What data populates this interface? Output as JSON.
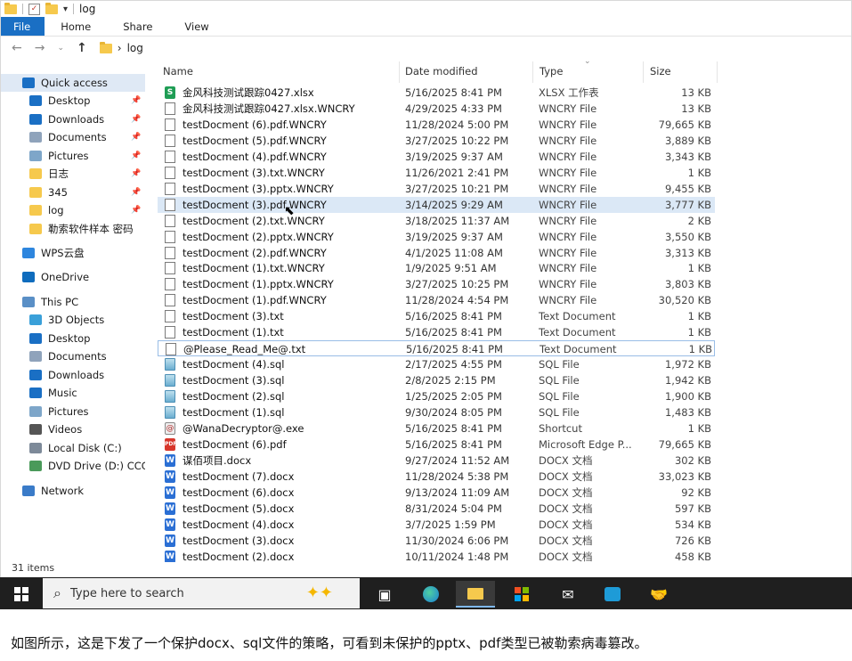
{
  "window": {
    "title": "log",
    "ribbon_tabs": [
      "File",
      "Home",
      "Share",
      "View"
    ],
    "address": "log",
    "breadcrumb_sep": "›"
  },
  "sidebar": {
    "items": [
      {
        "label": "Quick access",
        "icon": "star-icon",
        "color": "#1a6fc4",
        "pinned": false,
        "indent": 0,
        "selected": true
      },
      {
        "label": "Desktop",
        "icon": "desktop-icon",
        "color": "#1a6fc4",
        "pinned": true,
        "indent": 1
      },
      {
        "label": "Downloads",
        "icon": "download-icon",
        "color": "#1a6fc4",
        "pinned": true,
        "indent": 1
      },
      {
        "label": "Documents",
        "icon": "documents-icon",
        "color": "#8fa3bb",
        "pinned": true,
        "indent": 1
      },
      {
        "label": "Pictures",
        "icon": "pictures-icon",
        "color": "#7ea6c9",
        "pinned": true,
        "indent": 1
      },
      {
        "label": "日志",
        "icon": "folder-icon",
        "color": "#f6c94d",
        "pinned": true,
        "indent": 1
      },
      {
        "label": "345",
        "icon": "folder-icon",
        "color": "#f6c94d",
        "pinned": true,
        "indent": 1
      },
      {
        "label": "log",
        "icon": "folder-icon",
        "color": "#f6c94d",
        "pinned": true,
        "indent": 1
      },
      {
        "label": "勒索软件样本 密码",
        "icon": "folder-icon",
        "color": "#f6c94d",
        "pinned": false,
        "indent": 1
      },
      {
        "label": "WPS云盘",
        "icon": "cloud-icon",
        "color": "#2e86de",
        "pinned": false,
        "indent": 0
      },
      {
        "label": "OneDrive",
        "icon": "onedrive-icon",
        "color": "#0f6cbd",
        "pinned": false,
        "indent": 0
      },
      {
        "label": "This PC",
        "icon": "computer-icon",
        "color": "#5a8fc6",
        "pinned": false,
        "indent": 0
      },
      {
        "label": "3D Objects",
        "icon": "cube-icon",
        "color": "#3aa0d9",
        "pinned": false,
        "indent": 1
      },
      {
        "label": "Desktop",
        "icon": "desktop-icon",
        "color": "#1a6fc4",
        "pinned": false,
        "indent": 1
      },
      {
        "label": "Documents",
        "icon": "documents-icon",
        "color": "#8fa3bb",
        "pinned": false,
        "indent": 1
      },
      {
        "label": "Downloads",
        "icon": "download-icon",
        "color": "#1a6fc4",
        "pinned": false,
        "indent": 1
      },
      {
        "label": "Music",
        "icon": "music-icon",
        "color": "#1a6fc4",
        "pinned": false,
        "indent": 1
      },
      {
        "label": "Pictures",
        "icon": "pictures-icon",
        "color": "#7ea6c9",
        "pinned": false,
        "indent": 1
      },
      {
        "label": "Videos",
        "icon": "video-icon",
        "color": "#555555",
        "pinned": false,
        "indent": 1
      },
      {
        "label": "Local Disk (C:)",
        "icon": "disk-icon",
        "color": "#7d8a99",
        "pinned": false,
        "indent": 1
      },
      {
        "label": "DVD Drive (D:) CCC",
        "icon": "dvd-icon",
        "color": "#4a9a5a",
        "pinned": false,
        "indent": 1
      },
      {
        "label": "Network",
        "icon": "network-icon",
        "color": "#3a7bc8",
        "pinned": false,
        "indent": 0
      }
    ]
  },
  "columns": {
    "name": "Name",
    "date": "Date modified",
    "type": "Type",
    "size": "Size"
  },
  "files": [
    {
      "name": "金风科技测试跟踪0427.xlsx",
      "date": "5/16/2025 8:41 PM",
      "type": "XLSX 工作表",
      "size": "13 KB",
      "icon": "xlsx"
    },
    {
      "name": "金风科技测试跟踪0427.xlsx.WNCRY",
      "date": "4/29/2025 4:33 PM",
      "type": "WNCRY File",
      "size": "13 KB",
      "icon": "doc"
    },
    {
      "name": "testDocment (6).pdf.WNCRY",
      "date": "11/28/2024 5:00 PM",
      "type": "WNCRY File",
      "size": "79,665 KB",
      "icon": "doc"
    },
    {
      "name": "testDocment (5).pdf.WNCRY",
      "date": "3/27/2025 10:22 PM",
      "type": "WNCRY File",
      "size": "3,889 KB",
      "icon": "doc"
    },
    {
      "name": "testDocment (4).pdf.WNCRY",
      "date": "3/19/2025 9:37 AM",
      "type": "WNCRY File",
      "size": "3,343 KB",
      "icon": "doc"
    },
    {
      "name": "testDocment (3).txt.WNCRY",
      "date": "11/26/2021 2:41 PM",
      "type": "WNCRY File",
      "size": "1 KB",
      "icon": "doc"
    },
    {
      "name": "testDocment (3).pptx.WNCRY",
      "date": "3/27/2025 10:21 PM",
      "type": "WNCRY File",
      "size": "9,455 KB",
      "icon": "doc"
    },
    {
      "name": "testDocment (3).pdf.WNCRY",
      "date": "3/14/2025 9:29 AM",
      "type": "WNCRY File",
      "size": "3,777 KB",
      "icon": "doc",
      "selected": true
    },
    {
      "name": "testDocment (2).txt.WNCRY",
      "date": "3/18/2025 11:37 AM",
      "type": "WNCRY File",
      "size": "2 KB",
      "icon": "doc"
    },
    {
      "name": "testDocment (2).pptx.WNCRY",
      "date": "3/19/2025 9:37 AM",
      "type": "WNCRY File",
      "size": "3,550 KB",
      "icon": "doc"
    },
    {
      "name": "testDocment (2).pdf.WNCRY",
      "date": "4/1/2025 11:08 AM",
      "type": "WNCRY File",
      "size": "3,313 KB",
      "icon": "doc"
    },
    {
      "name": "testDocment (1).txt.WNCRY",
      "date": "1/9/2025 9:51 AM",
      "type": "WNCRY File",
      "size": "1 KB",
      "icon": "doc"
    },
    {
      "name": "testDocment (1).pptx.WNCRY",
      "date": "3/27/2025 10:25 PM",
      "type": "WNCRY File",
      "size": "3,803 KB",
      "icon": "doc"
    },
    {
      "name": "testDocment (1).pdf.WNCRY",
      "date": "11/28/2024 4:54 PM",
      "type": "WNCRY File",
      "size": "30,520 KB",
      "icon": "doc"
    },
    {
      "name": "testDocment (3).txt",
      "date": "5/16/2025 8:41 PM",
      "type": "Text Document",
      "size": "1 KB",
      "icon": "doc"
    },
    {
      "name": "testDocment (1).txt",
      "date": "5/16/2025 8:41 PM",
      "type": "Text Document",
      "size": "1 KB",
      "icon": "doc"
    },
    {
      "name": "@Please_Read_Me@.txt",
      "date": "5/16/2025 8:41 PM",
      "type": "Text Document",
      "size": "1 KB",
      "icon": "doc",
      "focus": true
    },
    {
      "name": "testDocment (4).sql",
      "date": "2/17/2025 4:55 PM",
      "type": "SQL File",
      "size": "1,972 KB",
      "icon": "sql"
    },
    {
      "name": "testDocment (3).sql",
      "date": "2/8/2025 2:15 PM",
      "type": "SQL File",
      "size": "1,942 KB",
      "icon": "sql"
    },
    {
      "name": "testDocment (2).sql",
      "date": "1/25/2025 2:05 PM",
      "type": "SQL File",
      "size": "1,900 KB",
      "icon": "sql"
    },
    {
      "name": "testDocment (1).sql",
      "date": "9/30/2024 8:05 PM",
      "type": "SQL File",
      "size": "1,483 KB",
      "icon": "sql"
    },
    {
      "name": "@WanaDecryptor@.exe",
      "date": "5/16/2025 8:41 PM",
      "type": "Shortcut",
      "size": "1 KB",
      "icon": "exe"
    },
    {
      "name": "testDocment (6).pdf",
      "date": "5/16/2025 8:41 PM",
      "type": "Microsoft Edge P...",
      "size": "79,665 KB",
      "icon": "pdf"
    },
    {
      "name": "谋佰项目.docx",
      "date": "9/27/2024 11:52 AM",
      "type": "DOCX 文档",
      "size": "302 KB",
      "icon": "docx"
    },
    {
      "name": "testDocment (7).docx",
      "date": "11/28/2024 5:38 PM",
      "type": "DOCX 文档",
      "size": "33,023 KB",
      "icon": "docx"
    },
    {
      "name": "testDocment (6).docx",
      "date": "9/13/2024 11:09 AM",
      "type": "DOCX 文档",
      "size": "92 KB",
      "icon": "docx"
    },
    {
      "name": "testDocment (5).docx",
      "date": "8/31/2024 5:04 PM",
      "type": "DOCX 文档",
      "size": "597 KB",
      "icon": "docx"
    },
    {
      "name": "testDocment (4).docx",
      "date": "3/7/2025 1:59 PM",
      "type": "DOCX 文档",
      "size": "534 KB",
      "icon": "docx"
    },
    {
      "name": "testDocment (3).docx",
      "date": "11/30/2024 6:06 PM",
      "type": "DOCX 文档",
      "size": "726 KB",
      "icon": "docx"
    },
    {
      "name": "testDocment (2).docx",
      "date": "10/11/2024 1:48 PM",
      "type": "DOCX 文档",
      "size": "458 KB",
      "icon": "docx"
    }
  ],
  "status": {
    "item_count": "31 items"
  },
  "taskbar": {
    "search_placeholder": "Type here to search",
    "apps": [
      "task-view-icon",
      "edge-icon",
      "file-explorer-icon",
      "store-icon",
      "mail-icon",
      "wps-icon",
      "handshake-icon"
    ]
  },
  "caption": "如图所示，这是下发了一个保护docx、sql文件的策略，可看到未保护的pptx、pdf类型已被勒索病毒篡改。",
  "colors": {
    "accent": "#1a6fc4",
    "selection": "#dbe8f6",
    "taskbar": "#1f1f1f"
  }
}
